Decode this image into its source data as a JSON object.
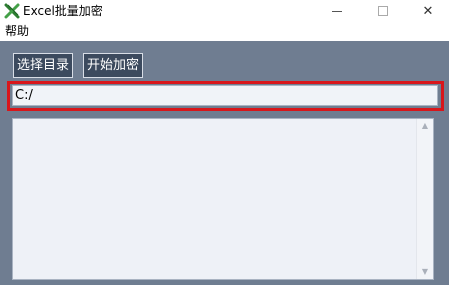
{
  "window": {
    "title": "Excel批量加密",
    "icon": "excel-x-icon",
    "close_glyph": "✕"
  },
  "menu": {
    "items": [
      {
        "label": "帮助"
      }
    ]
  },
  "toolbar": {
    "select_dir_label": "选择目录",
    "start_encrypt_label": "开始加密"
  },
  "path_field": {
    "value": "C:/"
  },
  "log": {
    "content": ""
  },
  "scrollbar": {
    "up_glyph": "▲",
    "down_glyph": "▼"
  },
  "colors": {
    "client_bg": "#6f7d91",
    "button_bg": "#3c4a5e",
    "highlight": "#d8161b",
    "field_bg": "#f0f3f8"
  }
}
